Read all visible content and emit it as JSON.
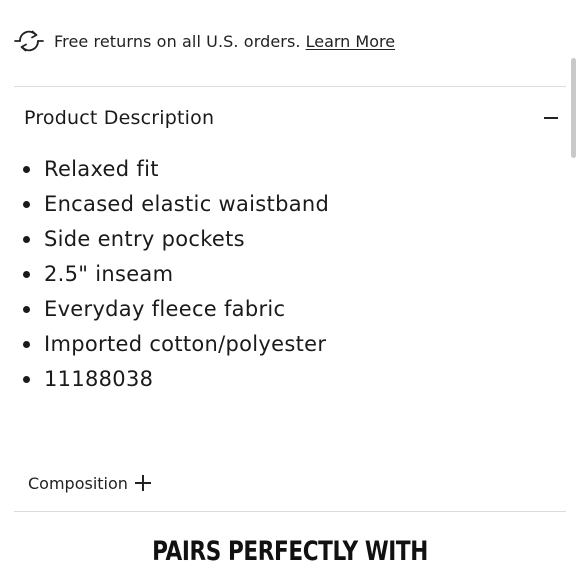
{
  "returns": {
    "icon": "returns-arrows-icon",
    "text": "Free returns on all U.S. orders.",
    "link_label": "Learn More"
  },
  "product_description": {
    "title": "Product Description",
    "toggle_icon": "minus-icon",
    "expanded": true,
    "items": [
      "Relaxed fit",
      "Encased elastic waistband",
      "Side entry pockets",
      "2.5\" inseam",
      "Everyday fleece fabric",
      "Imported cotton/polyester",
      "11188038"
    ]
  },
  "composition": {
    "label": "Composition",
    "toggle_icon": "plus-icon",
    "expanded": false
  },
  "pairs": {
    "heading": "PAIRS PERFECTLY WITH"
  },
  "colors": {
    "text": "#1a1a1a",
    "divider": "#dcdcdc",
    "scrollbar": "#c9c9c9",
    "background": "#ffffff"
  }
}
